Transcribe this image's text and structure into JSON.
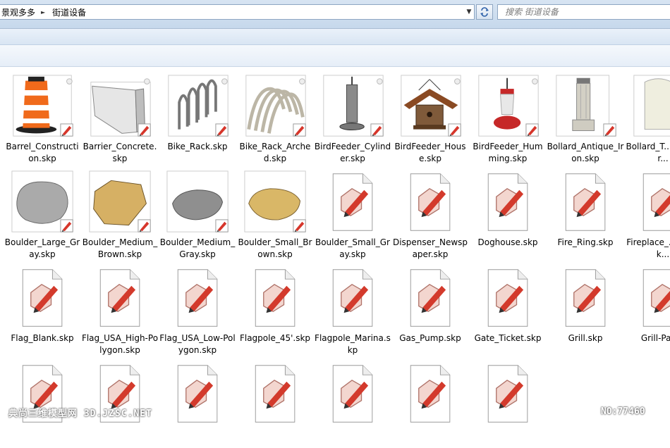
{
  "address_bar": {
    "crumbs": [
      "景观多多",
      "街道设备"
    ],
    "separator_icon": "chevron-right-icon",
    "dropdown_icon": "chevron-down-icon"
  },
  "refresh_icon": "refresh-icon",
  "search": {
    "placeholder": "搜索 街道设备"
  },
  "files": [
    {
      "label": "Barrel_Construction.skp",
      "thumb": "barrel"
    },
    {
      "label": "Barrier_Concrete.skp",
      "thumb": "barrier"
    },
    {
      "label": "Bike_Rack.skp",
      "thumb": "bikerack"
    },
    {
      "label": "Bike_Rack_Arched.skp",
      "thumb": "bikerackarched"
    },
    {
      "label": "BirdFeeder_Cylinder.skp",
      "thumb": "feedercyl"
    },
    {
      "label": "BirdFeeder_House.skp",
      "thumb": "feederhouse"
    },
    {
      "label": "BirdFeeder_Humming.skp",
      "thumb": "feederhum"
    },
    {
      "label": "Bollard_Antique_Iron.skp",
      "thumb": "bollard"
    },
    {
      "label": "Bollard_T... Barrier...",
      "thumb": "bollard2"
    },
    {
      "label": "Boulder_Large_Gray.skp",
      "thumb": "boulder_gray_large"
    },
    {
      "label": "Boulder_Medium_Brown.skp",
      "thumb": "boulder_brown_med"
    },
    {
      "label": "Boulder_Medium_Gray.skp",
      "thumb": "boulder_gray_med"
    },
    {
      "label": "Boulder_Small_Brown.skp",
      "thumb": "boulder_brown_small"
    },
    {
      "label": "Boulder_Small_Gray.skp",
      "thumb": "doc"
    },
    {
      "label": "Dispenser_Newspaper.skp",
      "thumb": "doc"
    },
    {
      "label": "Doghouse.skp",
      "thumb": "doc"
    },
    {
      "label": "Fire_Ring.skp",
      "thumb": "doc"
    },
    {
      "label": "Fireplace_... oor.sk...",
      "thumb": "doc"
    },
    {
      "label": "Flag_Blank.skp",
      "thumb": "doc"
    },
    {
      "label": "Flag_USA_High-Polygon.skp",
      "thumb": "doc"
    },
    {
      "label": "Flag_USA_Low-Polygon.skp",
      "thumb": "doc"
    },
    {
      "label": "Flagpole_45'.skp",
      "thumb": "doc"
    },
    {
      "label": "Flagpole_Marina.skp",
      "thumb": "doc"
    },
    {
      "label": "Gas_Pump.skp",
      "thumb": "doc"
    },
    {
      "label": "Gate_Ticket.skp",
      "thumb": "doc"
    },
    {
      "label": "Grill.skp",
      "thumb": "doc"
    },
    {
      "label": "Grill-Parl...",
      "thumb": "doc"
    },
    {
      "label": "",
      "thumb": "doc"
    },
    {
      "label": "",
      "thumb": "doc"
    },
    {
      "label": "",
      "thumb": "doc"
    },
    {
      "label": "",
      "thumb": "doc"
    },
    {
      "label": "",
      "thumb": "doc"
    },
    {
      "label": "",
      "thumb": "doc"
    },
    {
      "label": "",
      "thumb": "doc"
    }
  ],
  "watermark": {
    "left": "典尚三维模型网 3D.JZSC.NET",
    "right": "NO:77460"
  }
}
